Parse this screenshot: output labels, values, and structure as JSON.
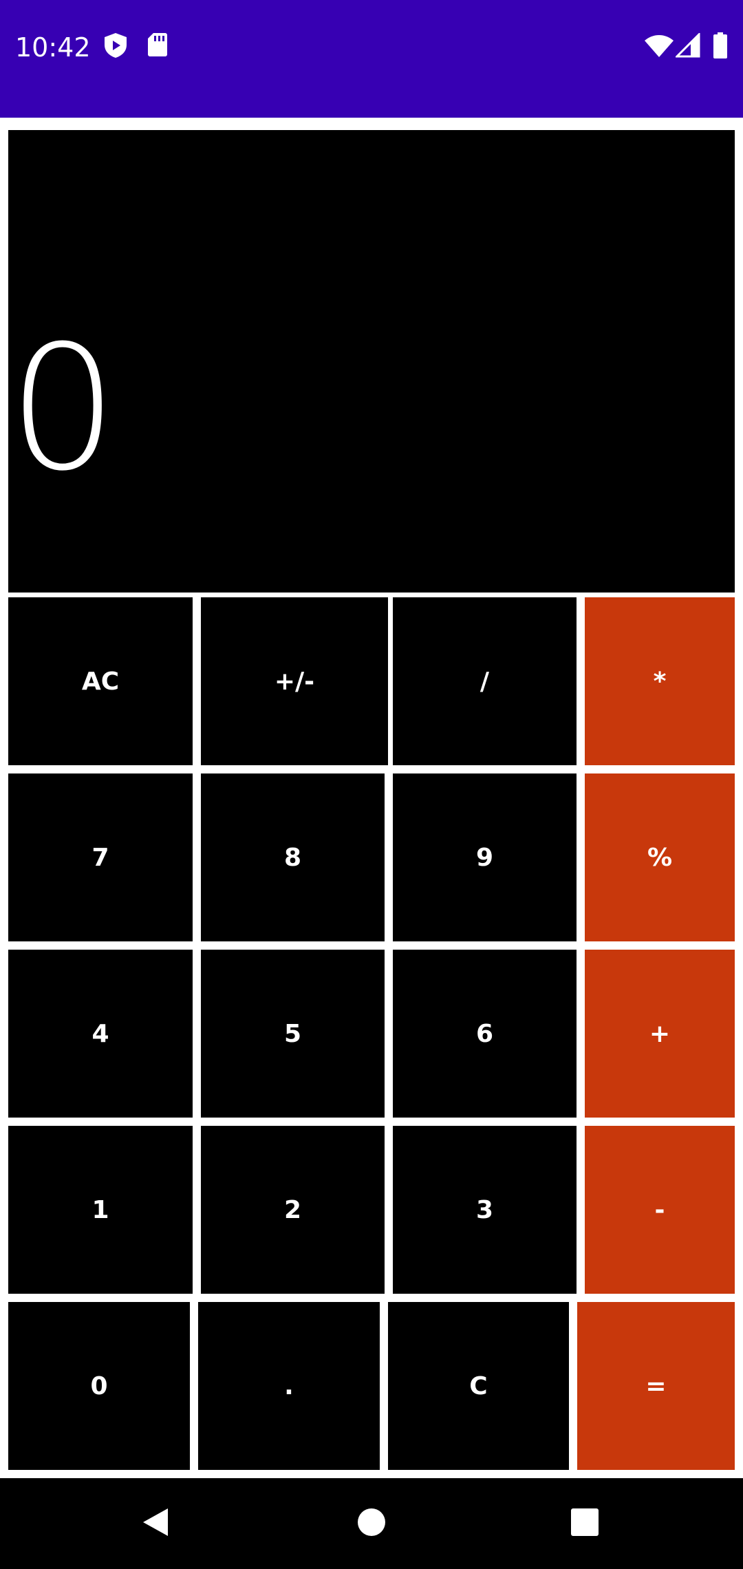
{
  "status_bar": {
    "time": "10:42",
    "background": "#3700b3",
    "icons_left": [
      "shield-icon",
      "sd-card-icon"
    ],
    "icons_right": [
      "wifi-icon",
      "cell-signal-icon",
      "battery-icon"
    ]
  },
  "display": {
    "value": "0"
  },
  "keypad": {
    "rows": [
      [
        {
          "label": "AC",
          "type": "function"
        },
        {
          "label": "+/-",
          "type": "function"
        },
        {
          "label": "/",
          "type": "function"
        },
        {
          "label": "*",
          "type": "operator"
        }
      ],
      [
        {
          "label": "7",
          "type": "digit"
        },
        {
          "label": "8",
          "type": "digit"
        },
        {
          "label": "9",
          "type": "digit"
        },
        {
          "label": "%",
          "type": "operator"
        }
      ],
      [
        {
          "label": "4",
          "type": "digit"
        },
        {
          "label": "5",
          "type": "digit"
        },
        {
          "label": "6",
          "type": "digit"
        },
        {
          "label": "+",
          "type": "operator"
        }
      ],
      [
        {
          "label": "1",
          "type": "digit"
        },
        {
          "label": "2",
          "type": "digit"
        },
        {
          "label": "3",
          "type": "digit"
        },
        {
          "label": "-",
          "type": "operator"
        }
      ],
      [
        {
          "label": "0",
          "type": "digit"
        },
        {
          "label": ".",
          "type": "digit"
        },
        {
          "label": "C",
          "type": "function"
        },
        {
          "label": "=",
          "type": "operator"
        }
      ]
    ]
  },
  "colors": {
    "operator": "#c8380c",
    "key": "#000000",
    "display": "#000000",
    "text": "#ffffff"
  },
  "nav_bar": {
    "buttons": [
      "back-icon",
      "home-icon",
      "recents-icon"
    ]
  }
}
